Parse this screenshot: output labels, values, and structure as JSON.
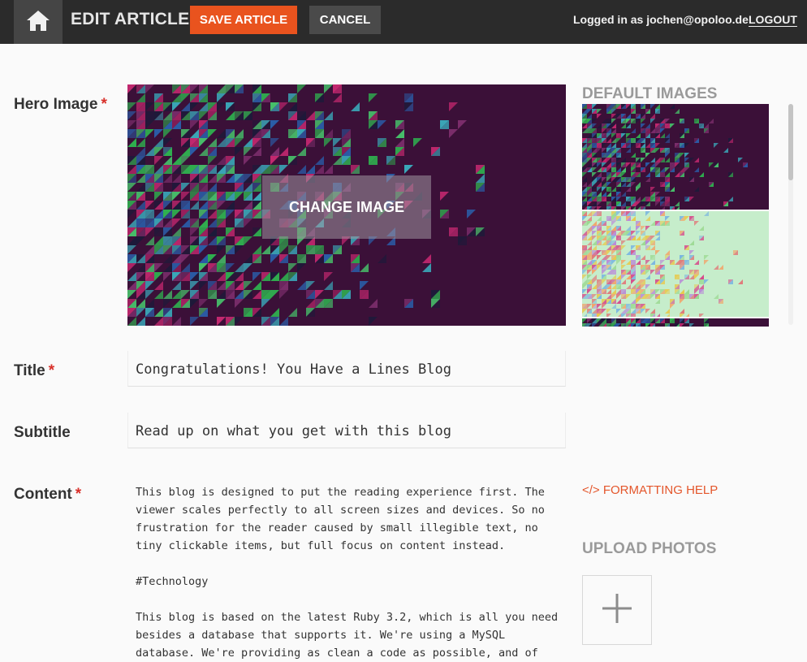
{
  "header": {
    "title": "EDIT ARTICLE",
    "save_label": "SAVE ARTICLE",
    "cancel_label": "CANCEL",
    "login_text": "Logged in as jochen@opoloo.de",
    "logout_label": "LOGOUT"
  },
  "form": {
    "hero_label": "Hero Image",
    "required_mark": "*",
    "change_image_label": "CHANGE IMAGE",
    "title_label": "Title",
    "title_value": "Congratulations! You Have a Lines Blog",
    "subtitle_label": "Subtitle",
    "subtitle_value": "Read up on what you get with this blog",
    "content_label": "Content",
    "content_value": "This blog is designed to put the reading experience first. The\nviewer scales perfectly to all screen sizes and devices. So no\nfrustration for the reader caused by small illegible text, no\ntiny clickable items, but full focus on content instead.\n\n#Technology\n\nThis blog is based on the latest Ruby 3.2, which is all you need\nbesides a database that supports it. We're using a MySQL\ndatabase. We're providing as clean a code as possible, and of"
  },
  "sidebar": {
    "default_images_title": "DEFAULT IMAGES",
    "formatting_help_label": "</> FORMATTING HELP",
    "upload_title": "UPLOAD PHOTOS"
  },
  "colors": {
    "accent": "#e9531e",
    "topbar": "#2b2b2b",
    "hero_bg": "#3b1038",
    "thumb2_bg": "#c6edcb",
    "required": "#d8302a"
  },
  "icons": {
    "home": "home-icon",
    "plus": "plus-icon"
  }
}
